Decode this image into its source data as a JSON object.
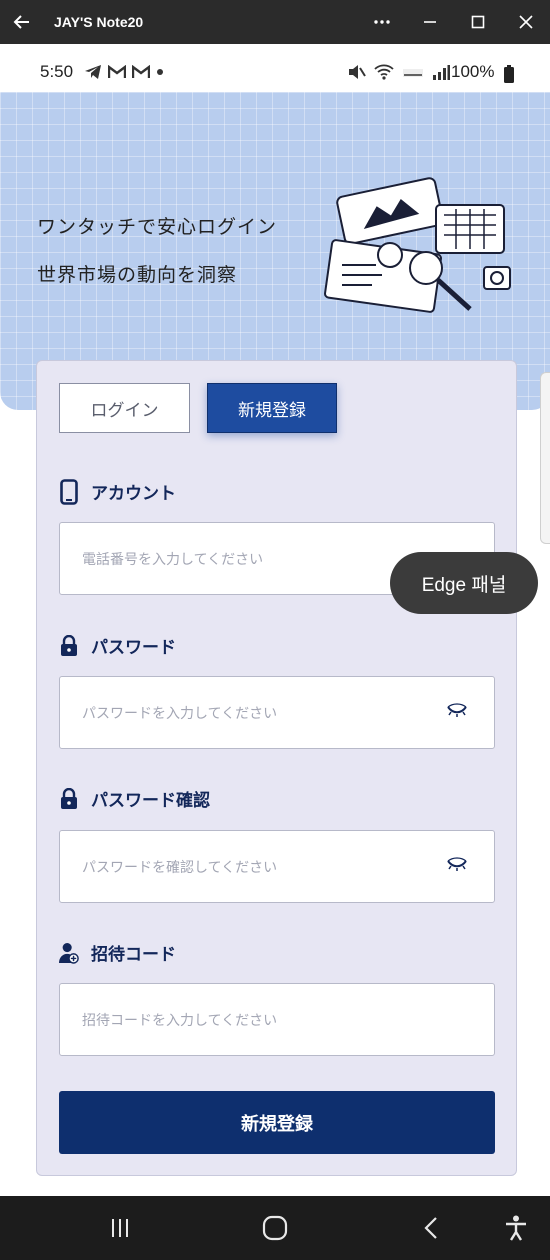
{
  "window": {
    "title": "JAY'S Note20"
  },
  "statusbar": {
    "time": "5:50",
    "battery": "100%"
  },
  "hero": {
    "line1": "ワンタッチで安心ログイン",
    "line2": "世界市場の動向を洞察"
  },
  "tabs": {
    "login": "ログイン",
    "register": "新規登録"
  },
  "form": {
    "account": {
      "label": "アカウント",
      "placeholder": "電話番号を入力してください"
    },
    "password": {
      "label": "パスワード",
      "placeholder": "パスワードを入力してください"
    },
    "password_confirm": {
      "label": "パスワード確認",
      "placeholder": "パスワードを確認してください"
    },
    "invite": {
      "label": "招待コード",
      "placeholder": "招待コードを入力してください"
    },
    "submit": "新規登録"
  },
  "edge_panel": {
    "label": "Edge 패널"
  },
  "icons": {
    "back": "arrow-left-icon",
    "more": "more-icon",
    "minimize": "minimize-icon",
    "maximize": "maximize-icon",
    "close": "close-icon",
    "phone": "phone-icon",
    "lock": "lock-icon",
    "user_add": "user-add-icon",
    "eye_closed": "eye-closed-icon",
    "recents": "recents-icon",
    "home": "home-icon",
    "nav_back": "nav-back-icon",
    "accessibility": "accessibility-icon"
  },
  "colors": {
    "primary": "#1e4ca0",
    "button_dark": "#0e2f6e",
    "hero_bg": "#b8cdee",
    "card_bg": "#e7e6f3",
    "label": "#13275a"
  }
}
